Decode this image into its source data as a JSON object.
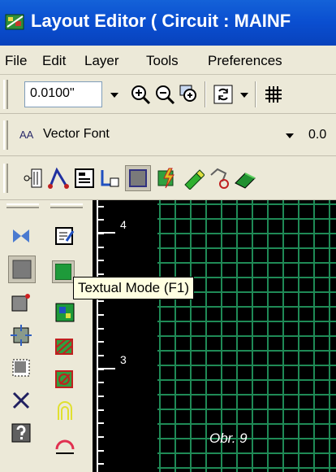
{
  "window": {
    "title": "Layout Editor ( Circuit : MAINF"
  },
  "menu": {
    "items": [
      "File",
      "Edit",
      "Layer",
      "Tools",
      "Preferences"
    ]
  },
  "toolbar_zoom": {
    "value": "0.0100\""
  },
  "toolbar_font": {
    "font_glyph": "AA",
    "font_name": "Vector Font",
    "size_value": "0.0"
  },
  "ruler": {
    "labels": [
      "4",
      "3"
    ]
  },
  "tooltip": {
    "text": "Textual Mode (F1)"
  },
  "caption": {
    "text": "Obr. 9"
  },
  "colors": {
    "title_bar": "#0a4ed0",
    "grid": "#1f8a56",
    "canvas": "#000000",
    "tooltip_bg": "#ffffe1"
  }
}
